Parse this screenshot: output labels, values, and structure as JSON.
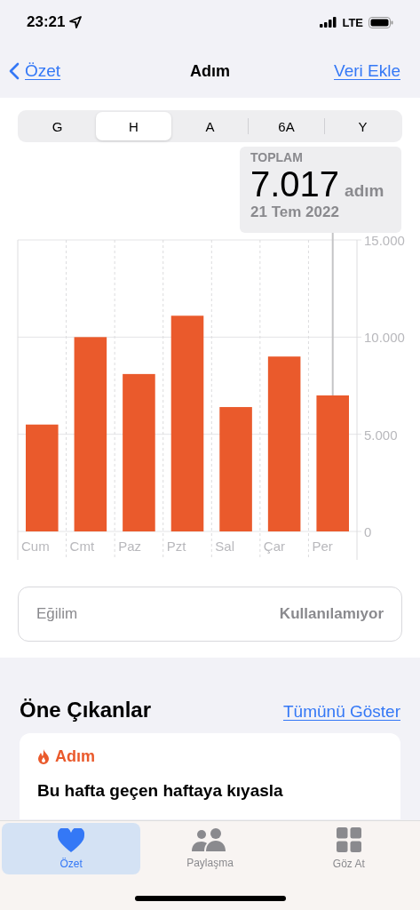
{
  "status_bar": {
    "time": "23:21",
    "network": "LTE"
  },
  "nav": {
    "back": "Özet",
    "title": "Adım",
    "action": "Veri Ekle"
  },
  "segments": [
    {
      "label": "G",
      "selected": false
    },
    {
      "label": "H",
      "selected": true
    },
    {
      "label": "A",
      "selected": false
    },
    {
      "label": "6A",
      "selected": false
    },
    {
      "label": "Y",
      "selected": false
    }
  ],
  "readout": {
    "label": "TOPLAM",
    "value": "7.017",
    "unit": "adım",
    "date": "21 Tem 2022"
  },
  "chart_data": {
    "type": "bar",
    "categories": [
      "Cum",
      "Cmt",
      "Paz",
      "Pzt",
      "Sal",
      "Çar",
      "Per"
    ],
    "series": [
      {
        "color": "#ea5a2c",
        "values": [
          5500,
          10000,
          8100,
          11100,
          6400,
          9000,
          7000
        ]
      }
    ],
    "ylim": [
      0,
      15000
    ],
    "yticks": [
      {
        "value": 0,
        "label": "0"
      },
      {
        "value": 5000,
        "label": "5.000"
      },
      {
        "value": 10000,
        "label": "10.000"
      },
      {
        "value": 15000,
        "label": "15.000"
      }
    ],
    "annotations": [
      {
        "x": "Per"
      }
    ]
  },
  "trend": {
    "label": "Eğilim",
    "value": "Kullanılamıyor"
  },
  "highlights": {
    "title": "Öne Çıkanlar",
    "link": "Tümünü Göster",
    "card": {
      "category": "Adım",
      "text": "Bu hafta geçen haftaya kıyasla"
    }
  },
  "tab_bar": [
    {
      "label": "Özet",
      "kind": "heart",
      "selected": true
    },
    {
      "label": "Paylaşma",
      "kind": "people",
      "selected": false
    },
    {
      "label": "Göz At",
      "kind": "grid",
      "selected": false
    }
  ]
}
